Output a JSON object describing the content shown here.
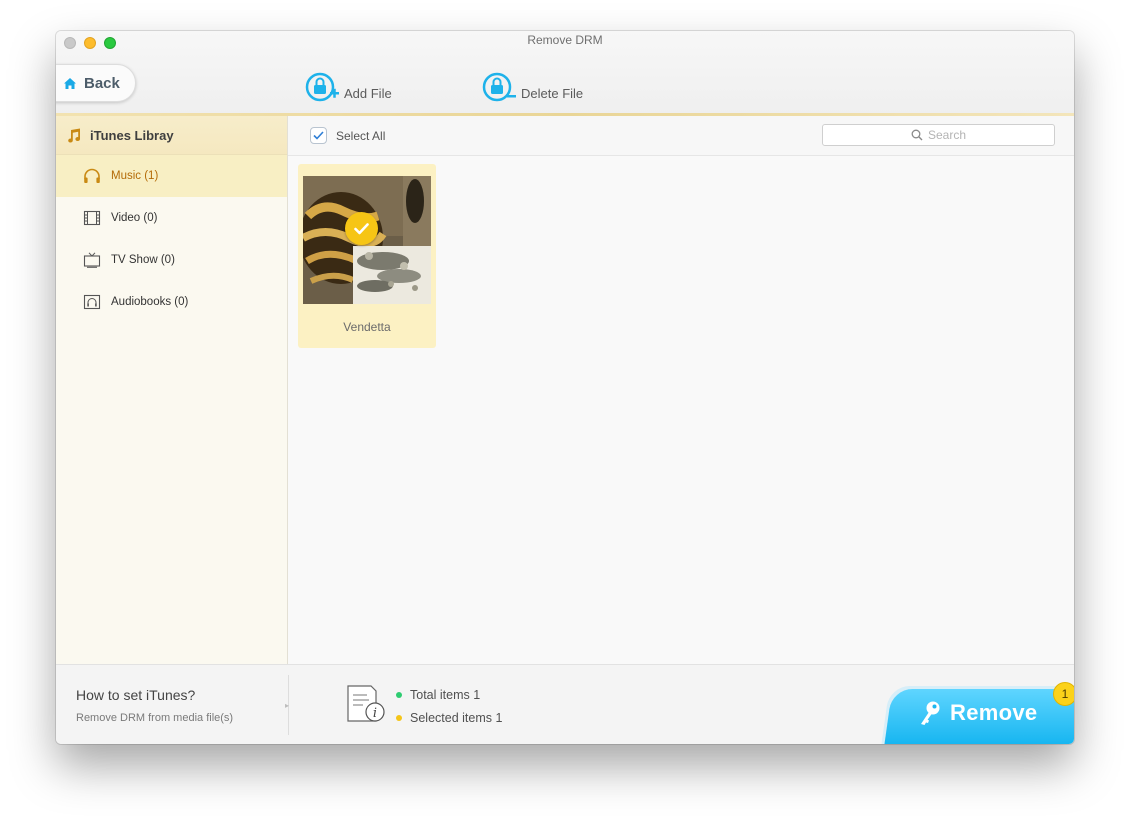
{
  "window": {
    "title": "Remove DRM"
  },
  "toolbar": {
    "back_label": "Back",
    "add_file_label": "Add File",
    "delete_file_label": "Delete File"
  },
  "sidebar": {
    "header": "iTunes Libray",
    "items": [
      {
        "label": "Music (1)",
        "icon": "headphones-icon",
        "active": true
      },
      {
        "label": "Video (0)",
        "icon": "film-icon",
        "active": false
      },
      {
        "label": "TV Show (0)",
        "icon": "tv-icon",
        "active": false
      },
      {
        "label": "Audiobooks (0)",
        "icon": "audiobook-icon",
        "active": false
      }
    ]
  },
  "main": {
    "select_all_label": "Select All",
    "select_all_checked": true,
    "search": {
      "placeholder": "Search"
    },
    "files": [
      {
        "name": "Vendetta",
        "selected": true
      }
    ]
  },
  "footer": {
    "help_title": "How to set iTunes?",
    "help_subtitle": "Remove DRM from media file(s)",
    "total_items": "Total items 1",
    "selected_items": "Selected items 1",
    "remove_label": "Remove",
    "remove_badge": "1"
  },
  "colors": {
    "accent_blue": "#11b3ef",
    "active_orange": "#b46b08",
    "selected_tile": "#fcf1c3",
    "badge_yellow": "#f6c515",
    "total_dot": "#2ecc71",
    "selected_dot": "#f5c518"
  }
}
